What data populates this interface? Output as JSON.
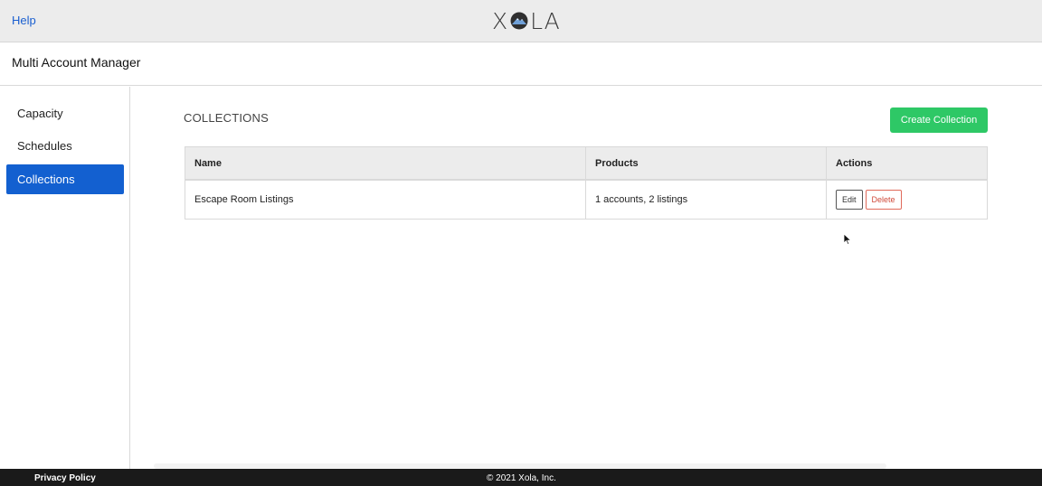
{
  "topbar": {
    "help_label": "Help",
    "logo_text_left": "X",
    "logo_text_right": "LA",
    "logo_icon": "mountain-o-icon"
  },
  "subheader": {
    "title": "Multi Account Manager"
  },
  "sidebar": {
    "items": [
      {
        "label": "Capacity",
        "active": false
      },
      {
        "label": "Schedules",
        "active": false
      },
      {
        "label": "Collections",
        "active": true
      }
    ]
  },
  "main": {
    "section_title": "COLLECTIONS",
    "create_button_label": "Create Collection",
    "table": {
      "headers": [
        "Name",
        "Products",
        "Actions"
      ],
      "rows": [
        {
          "name": "Escape Room Listings",
          "products": "1 accounts, 2 listings",
          "edit_label": "Edit",
          "delete_label": "Delete"
        }
      ]
    }
  },
  "footer": {
    "privacy_label": "Privacy Policy",
    "copyright": "© 2021 Xola, Inc."
  },
  "colors": {
    "accent_blue": "#1360d0",
    "create_green": "#2ec866",
    "delete_red": "#d04a3a",
    "footer_bg": "#1a1a1a"
  }
}
